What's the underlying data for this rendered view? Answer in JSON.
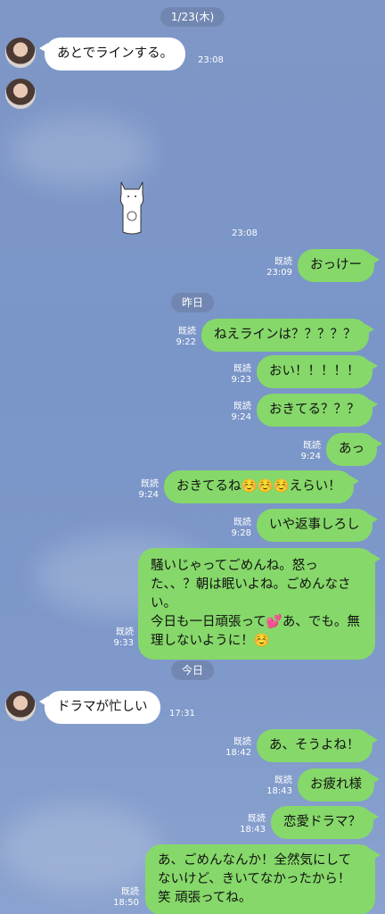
{
  "dates": {
    "d1": "1/23(木)",
    "d2": "昨日",
    "d3": "今日"
  },
  "messages": {
    "m1": {
      "text": "あとでラインする。",
      "time": "23:08"
    },
    "m2": {
      "time": "23:08"
    },
    "m3": {
      "read": "既読",
      "time": "23:09",
      "text": "おっけー"
    },
    "m4": {
      "read": "既読",
      "time": "9:22",
      "text": "ねえラインは？？？？？"
    },
    "m5": {
      "read": "既読",
      "time": "9:23",
      "text": "おい！！！！！"
    },
    "m6": {
      "read": "既読",
      "time": "9:24",
      "text": "おきてる？？？"
    },
    "m7": {
      "read": "既読",
      "time": "9:24",
      "text": "あっ"
    },
    "m8": {
      "read": "既読",
      "time": "9:24",
      "text": "おきてるね☺️☺️☺️えらい！"
    },
    "m9": {
      "read": "既読",
      "time": "9:28",
      "text": "いや返事しろし"
    },
    "m10": {
      "read": "既読",
      "time": "9:33",
      "line1": "騒いじゃってごめんね。怒った、、？朝は眠いよね。ごめんなさい。",
      "line2": "今日も一日頑張って💕あ、でも。無理しないように！☺️"
    },
    "m11": {
      "text": "ドラマが忙しい",
      "time": "17:31"
    },
    "m12": {
      "read": "既読",
      "time": "18:42",
      "text": "あ、そうよね！"
    },
    "m13": {
      "read": "既読",
      "time": "18:43",
      "text": "お疲れ様"
    },
    "m14": {
      "read": "既読",
      "time": "18:43",
      "text": "恋愛ドラマ？"
    },
    "m15": {
      "read": "既読",
      "time": "18:50",
      "text": "あ、ごめんなんか！全然気にしてないけど、きいてなかったから！笑 頑張ってね。"
    }
  },
  "colors": {
    "outgoing": "#86d86a",
    "incoming": "#ffffff",
    "background": "#7e97c6"
  },
  "icons": {
    "sticker": "cat-sticker-icon",
    "avatar": "avatar-photo"
  }
}
